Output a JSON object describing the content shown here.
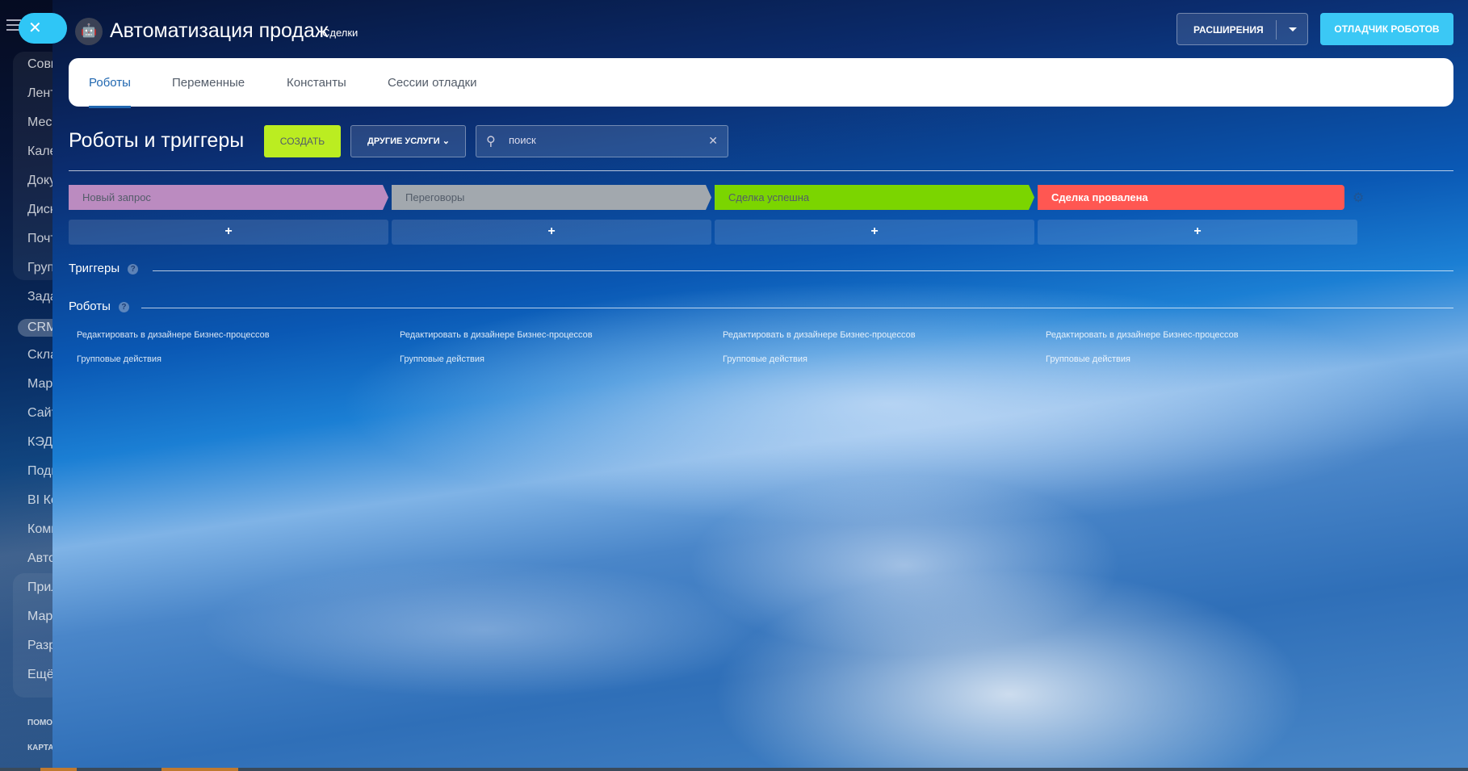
{
  "sidebar": {
    "close_icon": "✕",
    "groups_items": [
      "Совм",
      "Лент",
      "Месс",
      "Кале",
      "Доку",
      "Диск",
      "Почт",
      "Груп",
      "Зада",
      "CRM",
      "Скла",
      "Мар",
      "Сайт",
      "КЭДО",
      "Подп",
      "BI Ко",
      "Комп",
      "Авто",
      "Прил",
      "Мар",
      "Разр",
      "Ещё"
    ],
    "footer": [
      "ПОМО",
      "КАРТА"
    ]
  },
  "header": {
    "title": "Автоматизация продаж",
    "subtitle": "Сделки",
    "extensions": "РАСШИРЕНИЯ",
    "debugger": "ОТЛАДЧИК РОБОТОВ"
  },
  "tabs": [
    "Роботы",
    "Переменные",
    "Константы",
    "Сессии отладки"
  ],
  "toolbar": {
    "heading": "Роботы и триггеры",
    "create": "СОЗДАТЬ",
    "other": "ДРУГИЕ УСЛУГИ",
    "search_placeholder": "поиск"
  },
  "stages": [
    {
      "name": "Новый запрос",
      "color": "#bb8bc0"
    },
    {
      "name": "Переговоры",
      "color": "#a2a8ae"
    },
    {
      "name": "Сделка успешна",
      "color": "#7bd500"
    },
    {
      "name": "Сделка провалена",
      "color": "#ff5752"
    }
  ],
  "add_label": "+",
  "sections": {
    "triggers": "Триггеры",
    "robots": "Роботы",
    "help": "?"
  },
  "links": {
    "edit": "Редактировать в дизайнере Бизнес-процессов",
    "group": "Групповые действия"
  }
}
